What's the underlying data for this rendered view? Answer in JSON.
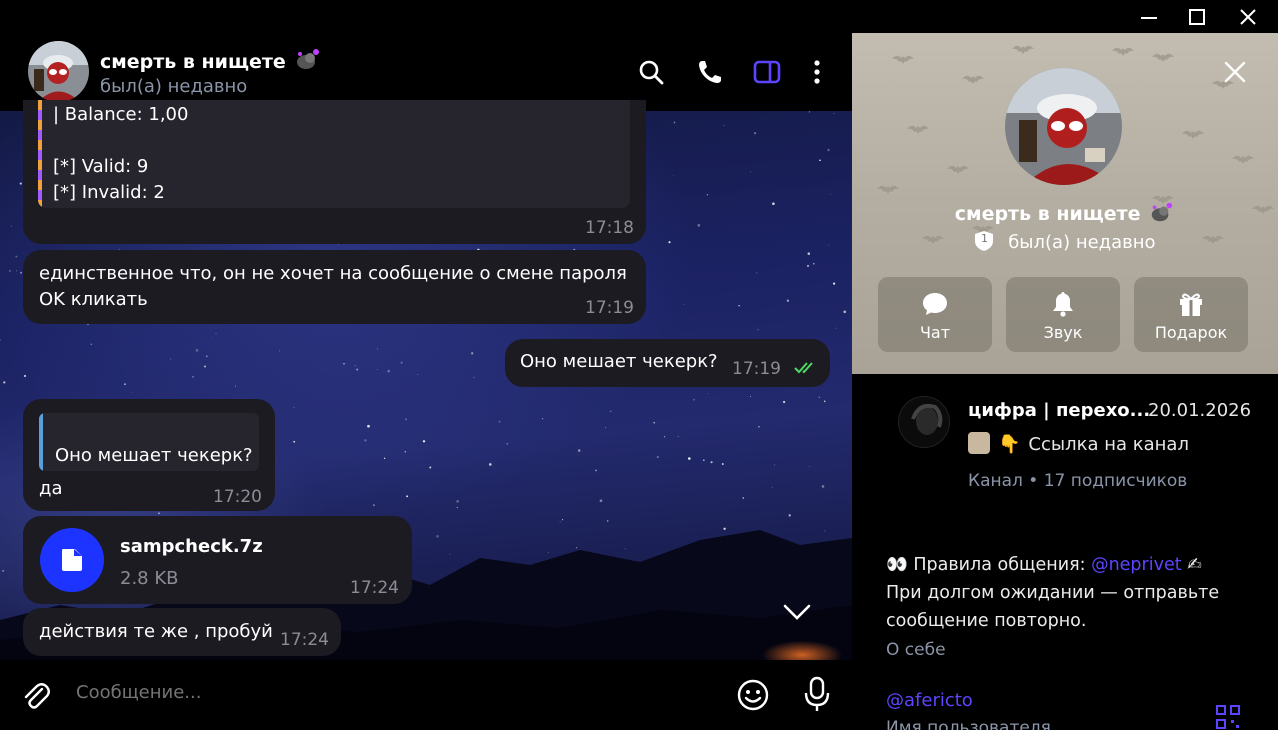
{
  "window": {
    "controls": [
      "minimize",
      "maximize",
      "close"
    ]
  },
  "header": {
    "contact_name": "смерть в нищете",
    "status": "был(а) недавно",
    "icons": [
      "search-icon",
      "phone-icon",
      "sidebar-toggle-icon",
      "more-icon"
    ],
    "accent_color": "#5b45ff"
  },
  "messages": [
    {
      "id": "balance",
      "direction": "in",
      "quote_text": "| Balance: 1,00\n\n[*] Valid: 9\n[*] Invalid: 2",
      "time": "17:18"
    },
    {
      "id": "password",
      "direction": "in",
      "text_line1": "единственное что, он не хочет на сообщение о смене пароля",
      "text_line2": "OK кликать",
      "time": "17:19"
    },
    {
      "id": "out",
      "direction": "out",
      "text": "Оно мешает чекерк?",
      "time": "17:19",
      "read": true
    },
    {
      "id": "reply",
      "direction": "in",
      "reply_to": "Оно мешает чекерк?",
      "text": "да",
      "time": "17:20"
    },
    {
      "id": "file",
      "direction": "in",
      "file_name": "sampcheck.7z",
      "file_size": "2.8 KB",
      "time": "17:24"
    },
    {
      "id": "try",
      "direction": "in",
      "text": "действия те же , пробуй",
      "time": "17:24"
    }
  ],
  "composer": {
    "placeholder": "Сообщение..."
  },
  "profile": {
    "name": "смерть в нищете",
    "status": "был(а) недавно",
    "status_badge": "1",
    "actions": [
      {
        "label": "Чат",
        "icon": "chat-icon"
      },
      {
        "label": "Звук",
        "icon": "bell-icon"
      },
      {
        "label": "Подарок",
        "icon": "gift-icon"
      }
    ],
    "channel": {
      "name": "цифра | перехо...",
      "date": "20.01.2026",
      "last_message": "Ссылка на канал",
      "meta": "Канал • 17 подписчиков"
    },
    "bio": {
      "prefix": "👀 Правила общения: ",
      "mention": "@neprivet",
      "suffix": " ✍",
      "line2": "При долгом ожидании — отправьте",
      "line3": "сообщение повторно.",
      "label": "О себе"
    },
    "username": "@afericto",
    "username_label": "Имя пользователя"
  }
}
